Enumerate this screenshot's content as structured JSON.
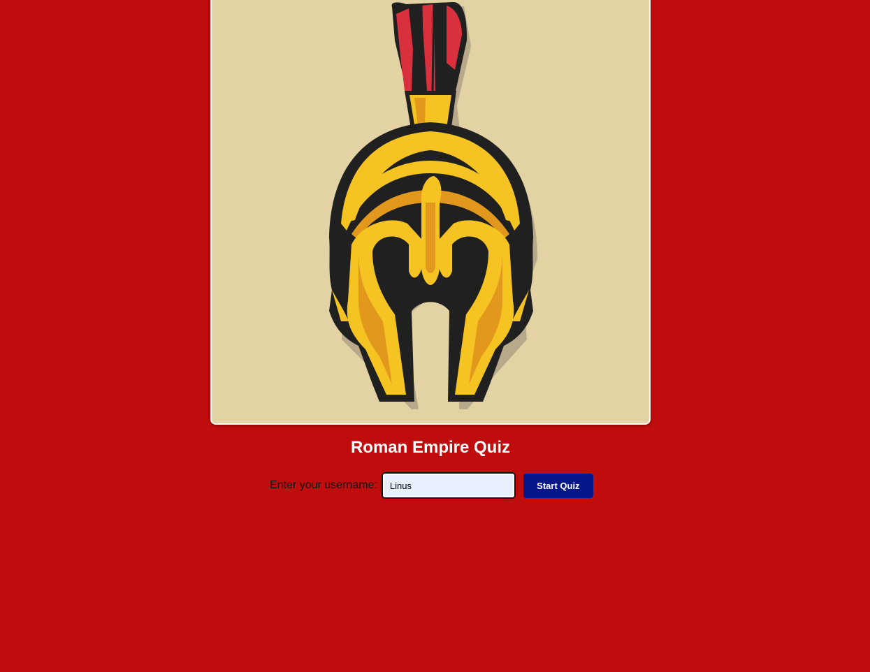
{
  "hero": {
    "image_icon": "roman-helmet-icon"
  },
  "page": {
    "title": "Roman Empire Quiz"
  },
  "login": {
    "label": "Enter your username:",
    "username_value": "Linus",
    "start_button_label": "Start Quiz"
  },
  "colors": {
    "background": "#bf0c0c",
    "card": "#e3d3a4",
    "button": "#07178a",
    "input": "#e8f0fe"
  }
}
